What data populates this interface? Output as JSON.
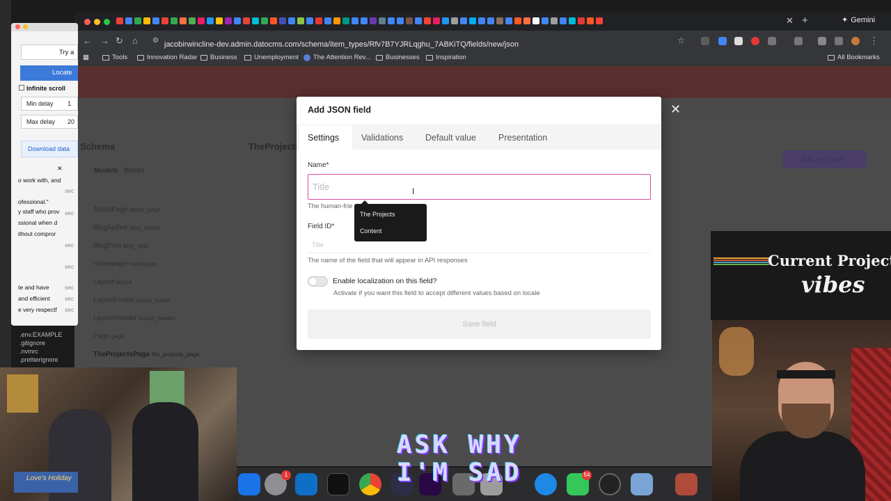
{
  "browser": {
    "url": "jacobirwincline-dev.admin.datocms.com/schema/item_types/Rfv7B7YJRLqghu_7ABKiTQ/fields/new/json",
    "gemini_label": "Gemini",
    "bookmarks": [
      "Tools",
      "Innovation Radar",
      "Business",
      "Unemployment",
      "The Attention Rev...",
      "Businesses",
      "Inspiration"
    ],
    "all_bookmarks": "All Bookmarks"
  },
  "cms": {
    "schema_title": "Schema",
    "page_title": "TheProjects",
    "models_label": "Models",
    "blocks_label": "Blocks",
    "add_new_field": "Add new field",
    "models": [
      {
        "name": "AboutPage",
        "api": "about_page"
      },
      {
        "name": "BlogAuthor",
        "api": "blog_author"
      },
      {
        "name": "BlogPost",
        "api": "blog_post"
      },
      {
        "name": "Homepage",
        "api": "homepage"
      },
      {
        "name": "Layout",
        "api": "layout"
      },
      {
        "name": "LayoutFooter",
        "api": "layout_footer"
      },
      {
        "name": "LayoutHeader",
        "api": "layout_header"
      },
      {
        "name": "Page",
        "api": "page"
      },
      {
        "name": "TheProjectsPage",
        "api": "the_projects_page"
      }
    ]
  },
  "modal": {
    "title": "Add JSON field",
    "tabs": [
      "Settings",
      "Validations",
      "Default value",
      "Presentation"
    ],
    "name_label": "Name*",
    "name_placeholder": "Title",
    "name_hint": "The human-frie",
    "field_id_label": "Field ID*",
    "field_id_placeholder": "Title",
    "field_id_hint": "The name of the field that will appear in API responses",
    "localization_label": "Enable localization on this field?",
    "localization_hint": "Activate if you want this field to accept different values based on locale",
    "save_label": "Save field",
    "suggestions": [
      "The Projects",
      "Content"
    ]
  },
  "left_app": {
    "try_label": "Try a",
    "locate_label": "Locate",
    "infinite_scroll": "Infinite scroll",
    "min_delay_label": "Min delay",
    "min_delay_value": "1",
    "max_delay_label": "Max delay",
    "max_delay_value": "20",
    "download_label": "Download data",
    "close_label": "✕",
    "text_lines": [
      "o work with, and",
      "ofessional.\"",
      "y staff who prov",
      "ssional when d",
      "ithout compror",
      "te and have",
      "and efficient",
      "e very respectf"
    ],
    "sec_labels": [
      "sec",
      "sec",
      "sec",
      "sec",
      "sec",
      "sec",
      "sec"
    ]
  },
  "files": [
    ".env.EXAMPLE",
    ".gitignore",
    ".nvmrc",
    ".prettierignore"
  ],
  "overlay": {
    "vibes_line1": "Current Project",
    "vibes_line2": "vibes",
    "caption_line1": "ASK WHY",
    "caption_line2": "I'M SAD",
    "loves_holiday": "Love's Holiday"
  },
  "dock": {
    "badge_settings": "1",
    "badge_messages": "54"
  },
  "colors": {
    "accent_pink": "#d64ca3",
    "cms_header": "#5a2f2f",
    "dock_bg": "#2c2c2e"
  }
}
